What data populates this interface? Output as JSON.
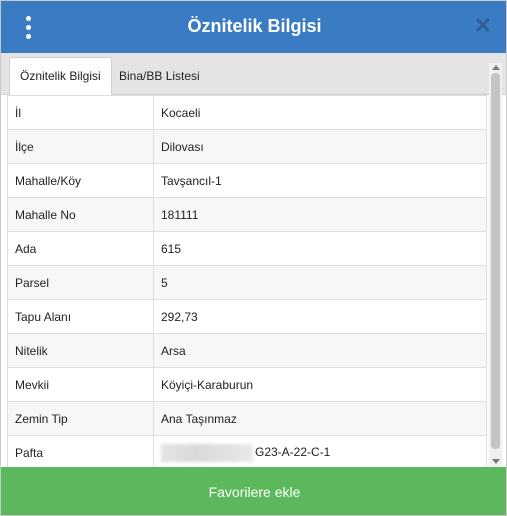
{
  "header": {
    "title": "Öznitelik Bilgisi",
    "close_symbol": "✕"
  },
  "tabs": [
    {
      "label": "Öznitelik Bilgisi",
      "active": true
    },
    {
      "label": "Bina/BB Listesi",
      "active": false
    }
  ],
  "rows": [
    {
      "key": "İl",
      "value": "Kocaeli"
    },
    {
      "key": "İlçe",
      "value": "Dilovası"
    },
    {
      "key": "Mahalle/Köy",
      "value": "Tavşancıl-1"
    },
    {
      "key": "Mahalle No",
      "value": "181111"
    },
    {
      "key": "Ada",
      "value": "615"
    },
    {
      "key": "Parsel",
      "value": "5"
    },
    {
      "key": "Tapu Alanı",
      "value": "292,73"
    },
    {
      "key": "Nitelik",
      "value": "Arsa"
    },
    {
      "key": "Mevkii",
      "value": "Köyiçi-Karaburun"
    },
    {
      "key": "Zemin Tip",
      "value": "Ana Taşınmaz"
    },
    {
      "key": "Pafta",
      "value": "G23-A-22-C-1"
    }
  ],
  "footer": {
    "button_label": "Favorilere ekle"
  },
  "colors": {
    "header": "#3a7cc4",
    "button": "#5cb85c"
  }
}
